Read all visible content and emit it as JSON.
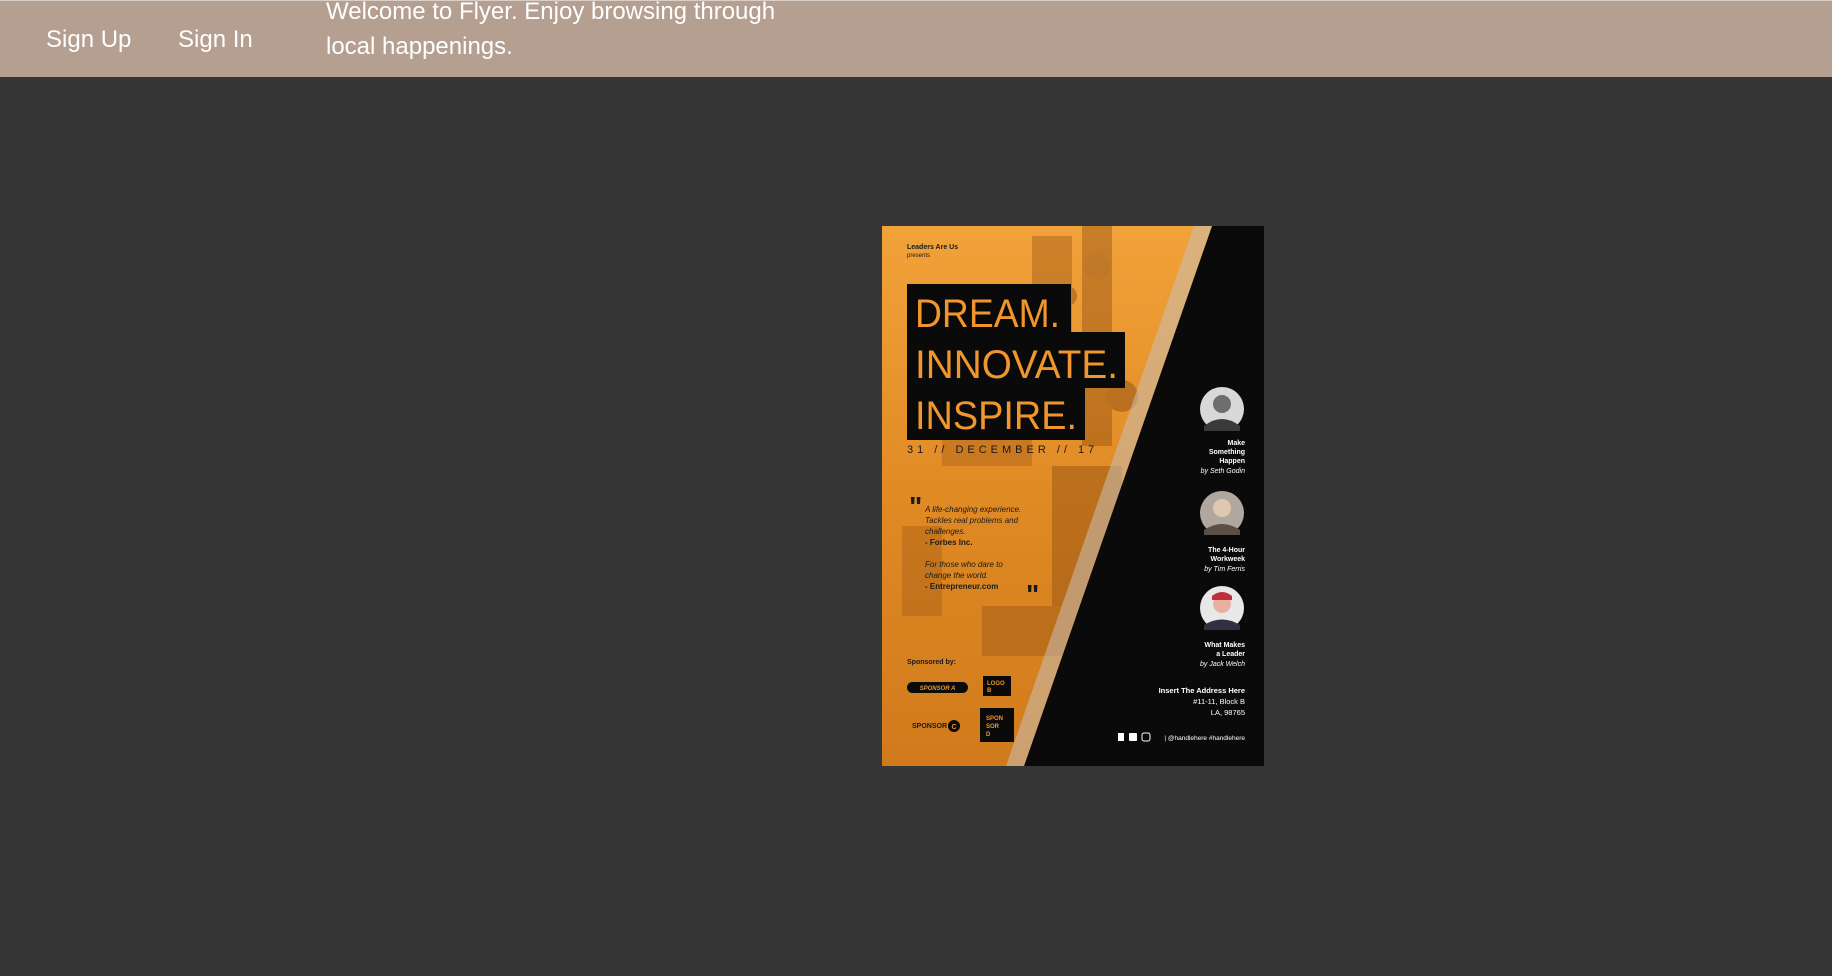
{
  "nav": {
    "signup_label": "Sign Up",
    "signin_label": "Sign In",
    "welcome_text": "Welcome to Flyer. Enjoy browsing through local happenings."
  },
  "flyer": {
    "presenter": "Leaders Are Us",
    "presents": "presents",
    "headline_1": "DREAM.",
    "headline_2": "INNOVATE.",
    "headline_3": "INSPIRE.",
    "date": "31 // DECEMBER // 17",
    "quote_1": "A life-changing experience.",
    "quote_2": "Tackles real problems and",
    "quote_3": "challenges.",
    "quote_4": "- Forbes Inc.",
    "quote_5": "For those who dare to",
    "quote_6": "change the world.",
    "quote_7": "- Entrepreneur.com",
    "sponsored_by": "Sponsored by:",
    "sponsor_a": "SPONSOR A",
    "logo_b_1": "LOGO",
    "logo_b_2": "B",
    "sponsor_c": "SPONSOR",
    "sponsor_c_mark": "C",
    "sponsor_d_1": "SPON",
    "sponsor_d_2": "SOR",
    "sponsor_d_3": "D",
    "speaker_1_title_1": "Make",
    "speaker_1_title_2": "Something",
    "speaker_1_title_3": "Happen",
    "speaker_1_by": "by Seth Godin",
    "speaker_2_title_1": "The 4-Hour",
    "speaker_2_title_2": "Workweek",
    "speaker_2_by": "by Tim Ferris",
    "speaker_3_title_1": "What Makes",
    "speaker_3_title_2": "a Leader",
    "speaker_3_by": "by Jack Welch",
    "address_1": "Insert The Address Here",
    "address_2": "#11-11, Block B",
    "address_3": "LA, 98765",
    "handles": "| @handlehere #handlehere"
  },
  "colors": {
    "navbar": "#b49f91",
    "background": "#363636",
    "flyer_orange": "#e8922a",
    "flyer_black": "#0a0a0a"
  }
}
